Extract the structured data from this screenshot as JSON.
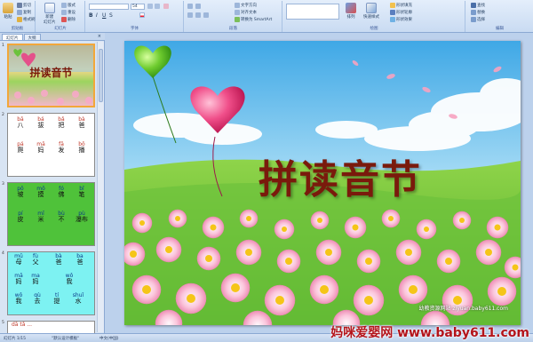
{
  "ribbon": {
    "clipboard": {
      "paste": "粘贴",
      "cut": "剪切",
      "copy": "复制",
      "format_painter": "格式刷",
      "label": "剪贴板"
    },
    "slides": {
      "new_slide": "新建\n幻灯片",
      "layout": "版式",
      "reset": "重设",
      "delete": "删除",
      "label": "幻灯片"
    },
    "font": {
      "size": "54",
      "label": "字体"
    },
    "paragraph": {
      "text_direction": "文字方向",
      "align_text": "对齐文本",
      "smartart": "转换为 SmartArt",
      "label": "段落"
    },
    "drawing": {
      "arrange": "排列",
      "quick_styles": "快速样式",
      "shape_fill": "形状填充",
      "shape_outline": "形状轮廓",
      "shape_effects": "形状效果",
      "label": "绘图"
    },
    "editing": {
      "find": "查找",
      "replace": "替换",
      "select": "选择",
      "label": "编辑"
    }
  },
  "left_panel": {
    "tabs": [
      "幻灯片",
      "大纲"
    ],
    "close": "×",
    "slides": [
      {
        "num": "1",
        "title": "拼读音节"
      },
      {
        "num": "2",
        "cells": [
          {
            "py": "bā",
            "hz": "八"
          },
          {
            "py": "bá",
            "hz": "拔"
          },
          {
            "py": "bǎ",
            "hz": "把"
          },
          {
            "py": "bà",
            "hz": "爸"
          },
          {
            "py": "pá",
            "hz": "爬"
          },
          {
            "py": "mā",
            "hz": "妈"
          },
          {
            "py": "fā",
            "hz": "发"
          },
          {
            "py": "bō",
            "hz": "播"
          }
        ]
      },
      {
        "num": "3",
        "cells": [
          {
            "py": "pō",
            "hz": "坡"
          },
          {
            "py": "mō",
            "hz": "摸"
          },
          {
            "py": "fó",
            "hz": "佛"
          },
          {
            "py": "bǐ",
            "hz": "笔"
          },
          {
            "py": "pí",
            "hz": "皮"
          },
          {
            "py": "mǐ",
            "hz": "米"
          },
          {
            "py": "bù",
            "hz": "不"
          },
          {
            "py": "pù",
            "hz": "瀑布"
          }
        ]
      },
      {
        "num": "4",
        "cells": [
          {
            "py": "mǔ",
            "hz": "母"
          },
          {
            "py": "fù",
            "hz": "父"
          },
          {
            "py": "bà",
            "hz": "爸"
          },
          {
            "py": "ba",
            "hz": "爸"
          },
          {
            "py": "mā",
            "hz": "妈"
          },
          {
            "py": "ma",
            "hz": "妈"
          },
          {
            "py": "wǒ",
            "hz": "我"
          },
          {
            "py": "wǒ",
            "hz": "我"
          },
          {
            "py": "qù",
            "hz": "去"
          },
          {
            "py": "tí",
            "hz": "提"
          },
          {
            "py": "shuǐ",
            "hz": "水"
          }
        ]
      },
      {
        "num": "5",
        "partial": "dā  tǎ  ..."
      }
    ]
  },
  "slide": {
    "title": "拼读音节",
    "credit": "幼教资源网站  ziyuan.baby611.com"
  },
  "status": {
    "slide_info": "幻灯片 1/15",
    "theme": "\"默认设计模板\"",
    "language": "中文(中国)"
  },
  "watermark": "妈咪爱婴网 www.baby611.com",
  "colors": {
    "title": "#7a1a0c",
    "selection": "#f2a73a",
    "ribbon": "#c9dbf2"
  }
}
